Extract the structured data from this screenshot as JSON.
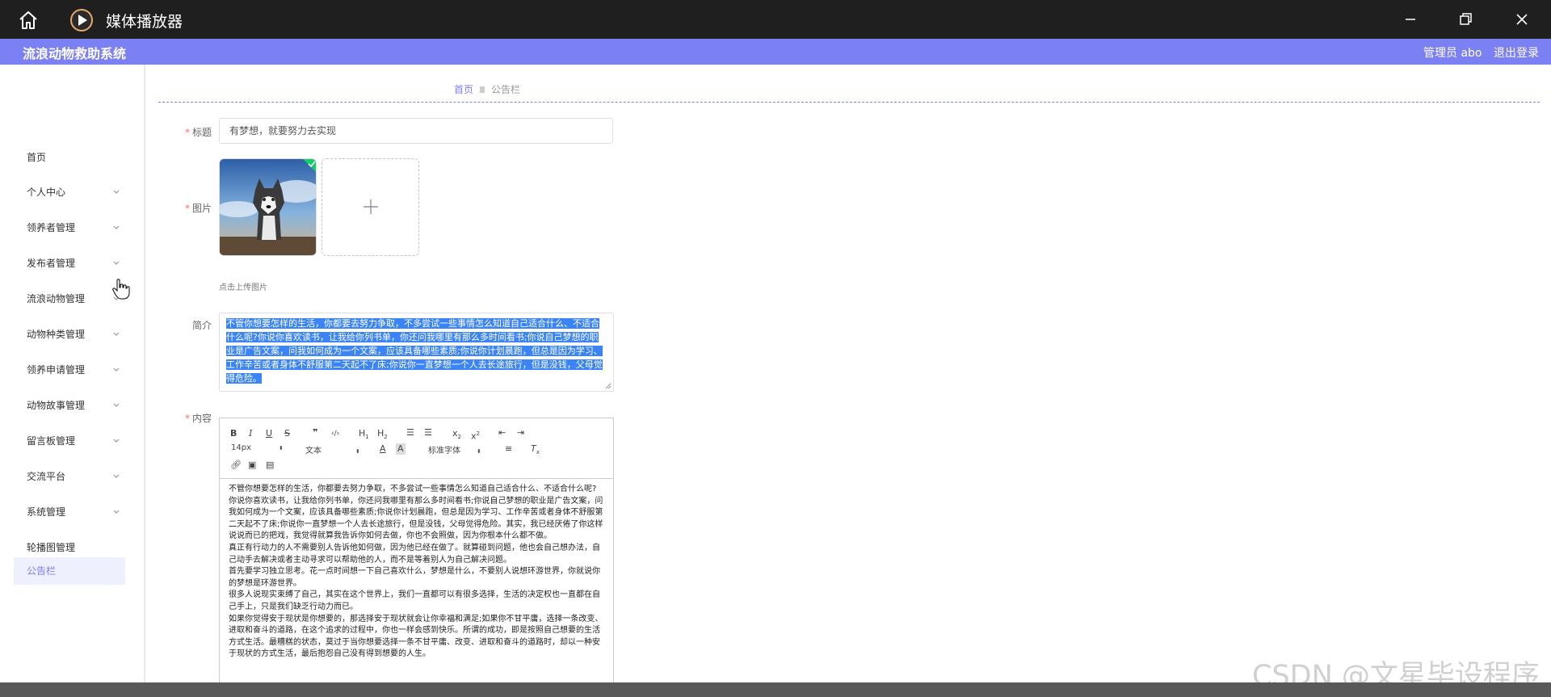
{
  "window": {
    "title": "媒体播放器"
  },
  "header": {
    "system_name": "流浪动物救助系统",
    "admin": "管理员 abo",
    "logout": "退出登录"
  },
  "sidebar": {
    "items": [
      {
        "label": "首页",
        "expandable": false,
        "active": false
      },
      {
        "label": "个人中心",
        "expandable": true,
        "active": false
      },
      {
        "label": "领养者管理",
        "expandable": true,
        "active": false
      },
      {
        "label": "发布者管理",
        "expandable": true,
        "active": false
      },
      {
        "label": "流浪动物管理",
        "expandable": true,
        "active": false
      },
      {
        "label": "动物种类管理",
        "expandable": true,
        "active": false
      },
      {
        "label": "领养申请管理",
        "expandable": true,
        "active": false
      },
      {
        "label": "动物故事管理",
        "expandable": true,
        "active": false
      },
      {
        "label": "留言板管理",
        "expandable": true,
        "active": false
      },
      {
        "label": "交流平台",
        "expandable": true,
        "active": false
      },
      {
        "label": "系统管理",
        "expandable": true,
        "active": false
      },
      {
        "label": "轮播图管理",
        "expandable": false,
        "active": false
      },
      {
        "label": "公告栏",
        "expandable": false,
        "active": true
      }
    ]
  },
  "breadcrumb": {
    "home": "首页",
    "current": "公告栏"
  },
  "form": {
    "title_label": "标题",
    "title_value": "有梦想，就要努力去实现",
    "image_label": "图片",
    "upload_tip": "点击上传图片",
    "intro_label": "简介",
    "intro_text": "不管你想要怎样的生活，你都要去努力争取，不多尝试一些事情怎么知道自己适合什么、不适合什么呢?你说你喜欢读书，让我给你列书单，你还问我哪里有那么多时间看书;你说自己梦想的职业是广告文案，问我如何成为一个文案，应该具备哪些素质;你说你计划晨跑，但总是因为学习、工作辛苦或者身体不舒服第二天起不了床;你说你一直梦想一个人去长途旅行，但是没钱，父母觉得危险。",
    "content_label": "内容"
  },
  "editor": {
    "font_size": "14px",
    "heading": "文本",
    "font_family": "标准字体",
    "paragraphs": [
      "不管你想要怎样的生活，你都要去努力争取，不多尝试一些事情怎么知道自己适合什么、不适合什么呢?",
      "你说你喜欢读书，让我给你列书单，你还问我哪里有那么多时间看书;你说自己梦想的职业是广告文案，问我如何成为一个文案，应该具备哪些素质;你说你计划晨跑，但总是因为学习、工作辛苦或者身体不舒服第二天起不了床;你说你一直梦想一个人去长途旅行，但是没钱，父母觉得危险。其实，我已经厌倦了你这样说说而已的把戏，我觉得就算我告诉你如何去做，你也不会照做，因为你根本什么都不做。",
      "真正有行动力的人不需要别人告诉他如何做，因为他已经在做了。就算碰到问题，他也会自己想办法，自己动手去解决或者主动寻求可以帮助他的人，而不是等着别人为自己解决问题。",
      "首先要学习独立思考。花一点时间想一下自己喜欢什么，梦想是什么，不要别人说想环游世界，你就说你的梦想是环游世界。",
      "很多人说现实束缚了自己，其实在这个世界上，我们一直都可以有很多选择，生活的决定权也一直都在自己手上，只是我们缺乏行动力而已。",
      "如果你觉得安于现状是你想要的，那选择安于现状就会让你幸福和满足;如果你不甘平庸，选择一条改变、进取和奋斗的道路，在这个追求的过程中，你也一样会感到快乐。所谓的成功，即是按照自己想要的生活方式生活。最糟糕的状态，莫过于当你想要选择一条不甘平庸、改变、进取和奋斗的道路时，却以一种安于现状的方式生活，最后抱怨自己没有得到想要的人生。"
    ]
  },
  "watermark": "CSDN @文星毕设程序"
}
